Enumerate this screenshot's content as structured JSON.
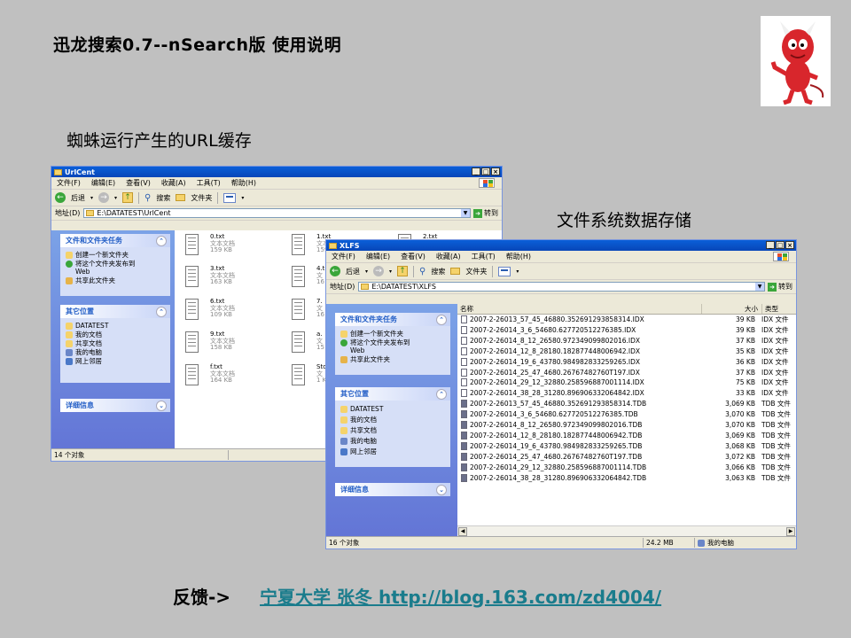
{
  "slide": {
    "title": "迅龙搜索0.7--nSearch版  使用说明",
    "caption_url_cache": "蜘蛛运行产生的URL缓存",
    "caption_fs": "文件系统数据存储",
    "footer_label": "反馈->",
    "footer_link": "宁夏大学 张冬  http://blog.163.com/zd4004/"
  },
  "menu": [
    "文件(F)",
    "编辑(E)",
    "查看(V)",
    "收藏(A)",
    "工具(T)",
    "帮助(H)"
  ],
  "toolbar": {
    "back": "后退",
    "search": "搜索",
    "folders": "文件夹"
  },
  "address": {
    "label": "地址(D)",
    "go": "转到"
  },
  "tasks": {
    "file_tasks_title": "文件和文件夹任务",
    "file_tasks": [
      "创建一个新文件夹",
      "将这个文件夹发布到",
      "Web",
      "共享此文件夹"
    ],
    "other_title": "其它位置",
    "other_places": [
      "DATATEST",
      "我的文档",
      "共享文档",
      "我的电脑",
      "网上邻居"
    ],
    "details_title": "详细信息"
  },
  "win1": {
    "title": "UrlCent",
    "path": "E:\\DATATEST\\UrlCent",
    "status": "14 个对象",
    "items": [
      {
        "name": "0.txt",
        "type": "文本文档",
        "size": "159 KB"
      },
      {
        "name": "1.txt",
        "type": "文本文档",
        "size": "159 KB"
      },
      {
        "name": "2.txt",
        "type": "",
        "size": ""
      },
      {
        "name": "3.txt",
        "type": "文本文档",
        "size": "163 KB"
      },
      {
        "name": "4.t",
        "type": "文",
        "size": "16"
      },
      {
        "name": "6.txt",
        "type": "文本文档",
        "size": "109 KB"
      },
      {
        "name": "7.",
        "type": "文",
        "size": "16"
      },
      {
        "name": "9.txt",
        "type": "文本文档",
        "size": "158 KB"
      },
      {
        "name": "a.",
        "type": "文",
        "size": "15"
      },
      {
        "name": "f.txt",
        "type": "文本文档",
        "size": "164 KB"
      },
      {
        "name": "Sto",
        "type": "文",
        "size": "1 K"
      }
    ]
  },
  "win2": {
    "title": "XLFS",
    "path": "E:\\DATATEST\\XLFS",
    "columns": {
      "name": "名称",
      "size": "大小",
      "type": "类型"
    },
    "status": "16 个对象",
    "status_size": "24.2 MB",
    "status_loc": "我的电脑",
    "files": [
      {
        "name": "2007-2-26013_57_45_46880.352691293858314.IDX",
        "size": "39 KB",
        "type": "IDX 文件",
        "kind": "idx"
      },
      {
        "name": "2007-2-26014_3_6_54680.627720512276385.IDX",
        "size": "39 KB",
        "type": "IDX 文件",
        "kind": "idx"
      },
      {
        "name": "2007-2-26014_8_12_26580.972349099802016.IDX",
        "size": "37 KB",
        "type": "IDX 文件",
        "kind": "idx"
      },
      {
        "name": "2007-2-26014_12_8_28180.182877448006942.IDX",
        "size": "35 KB",
        "type": "IDX 文件",
        "kind": "idx"
      },
      {
        "name": "2007-2-26014_19_6_43780.984982833259265.IDX",
        "size": "36 KB",
        "type": "IDX 文件",
        "kind": "idx"
      },
      {
        "name": "2007-2-26014_25_47_4680.26767482760T197.IDX",
        "size": "37 KB",
        "type": "IDX 文件",
        "kind": "idx"
      },
      {
        "name": "2007-2-26014_29_12_32880.258596887001114.IDX",
        "size": "75 KB",
        "type": "IDX 文件",
        "kind": "idx"
      },
      {
        "name": "2007-2-26014_38_28_31280.896906332064842.IDX",
        "size": "33 KB",
        "type": "IDX 文件",
        "kind": "idx"
      },
      {
        "name": "2007-2-26013_57_45_46880.352691293858314.TDB",
        "size": "3,069 KB",
        "type": "TDB 文件",
        "kind": "tdb"
      },
      {
        "name": "2007-2-26014_3_6_54680.627720512276385.TDB",
        "size": "3,070 KB",
        "type": "TDB 文件",
        "kind": "tdb"
      },
      {
        "name": "2007-2-26014_8_12_26580.972349099802016.TDB",
        "size": "3,070 KB",
        "type": "TDB 文件",
        "kind": "tdb"
      },
      {
        "name": "2007-2-26014_12_8_28180.182877448006942.TDB",
        "size": "3,069 KB",
        "type": "TDB 文件",
        "kind": "tdb"
      },
      {
        "name": "2007-2-26014_19_6_43780.984982833259265.TDB",
        "size": "3,068 KB",
        "type": "TDB 文件",
        "kind": "tdb"
      },
      {
        "name": "2007-2-26014_25_47_4680.26767482760T197.TDB",
        "size": "3,072 KB",
        "type": "TDB 文件",
        "kind": "tdb"
      },
      {
        "name": "2007-2-26014_29_12_32880.258596887001114.TDB",
        "size": "3,066 KB",
        "type": "TDB 文件",
        "kind": "tdb"
      },
      {
        "name": "2007-2-26014_38_28_31280.896906332064842.TDB",
        "size": "3,063 KB",
        "type": "TDB 文件",
        "kind": "tdb"
      }
    ]
  }
}
